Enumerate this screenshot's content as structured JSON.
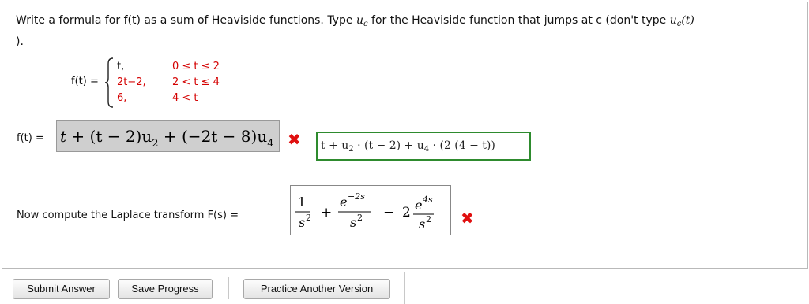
{
  "problem": {
    "prompt_main": "Write a formula for f(t) as a sum of Heaviside functions. Type ",
    "prompt_uc": "u",
    "prompt_uc_sub": "c",
    "prompt_mid": " for the Heaviside function that jumps at c (don't type ",
    "prompt_uc2": "u",
    "prompt_uc2_sub": "c",
    "prompt_uc2_arg": "(t)",
    "prompt_end": ")."
  },
  "piecewise": {
    "label": "f(t) =",
    "rows": [
      {
        "expr": "t,",
        "cond": "0 ≤ t ≤ 2"
      },
      {
        "expr": "2t−2,",
        "cond": "2 < t ≤ 4"
      },
      {
        "expr": "6,",
        "cond": "4 < t"
      }
    ]
  },
  "answer1": {
    "label": "f(t) =",
    "entered_a": "t",
    "entered_b": " + (t − 2)u",
    "entered_b_sub": "2",
    "entered_c": " + (−2t − 8)u",
    "entered_c_sub": "4",
    "status": "incorrect",
    "status_icon": "✖",
    "correct_a": "t + u",
    "correct_a_sub": "2",
    "correct_b": " · (t − 2) + u",
    "correct_b_sub": "4",
    "correct_c": " · (2 (4 − t))"
  },
  "answer2": {
    "label": "Now compute the Laplace transform F(s) =",
    "term1_num": "1",
    "term1_den": "s",
    "term1_exp": "2",
    "plus": "+",
    "term2_num": "e",
    "term2_num_exp": "−2s",
    "term2_den": "s",
    "term2_den_exp": "2",
    "minus": "−",
    "coef": "2",
    "term3_num": "e",
    "term3_num_exp": "4s",
    "term3_den": "s",
    "term3_den_exp": "2",
    "status": "incorrect",
    "status_icon": "✖"
  },
  "buttons": {
    "submit": "Submit Answer",
    "save": "Save Progress",
    "practice": "Practice Another Version"
  },
  "colors": {
    "error": "#e01010",
    "correct_border": "#2e8b2e",
    "condition_red": "#d40000",
    "entered_bg": "#cfcfcf"
  }
}
